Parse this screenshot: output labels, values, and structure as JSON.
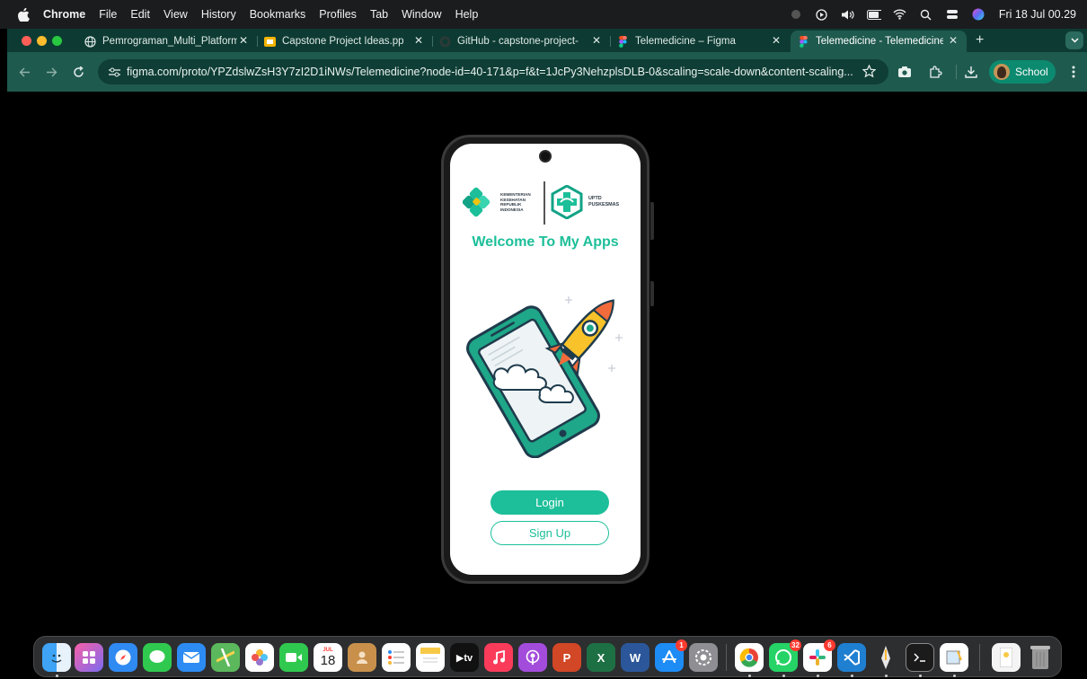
{
  "menubar": {
    "app_name": "Chrome",
    "items": [
      "File",
      "Edit",
      "View",
      "History",
      "Bookmarks",
      "Profiles",
      "Tab",
      "Window",
      "Help"
    ],
    "clock": "Fri 18 Jul 00.29"
  },
  "tabs": [
    {
      "title": "Pemrograman_Multi_Platform",
      "icon": "globe-icon"
    },
    {
      "title": "Capstone Project Ideas.pptx",
      "icon": "slides-icon"
    },
    {
      "title": "GitHub - capstone-project-pr",
      "icon": "github-icon"
    },
    {
      "title": "Telemedicine – Figma",
      "icon": "figma-icon"
    },
    {
      "title": "Telemedicine - Telemedicine",
      "icon": "figma-icon",
      "active": true
    }
  ],
  "toolbar": {
    "url": "figma.com/proto/YPZdslwZsH3Y7zI2D1iNWs/Telemedicine?node-id=40-171&p=f&t=1JcPy3NehzplsDLB-0&scaling=scale-down&content-scaling...",
    "profile_label": "School"
  },
  "app": {
    "kemenkes_lines": [
      "KEMENTERIAN",
      "KESEHATAN",
      "REPUBLIK",
      "INDONESIA"
    ],
    "puskesmas_lines": [
      "UPTD",
      "PUSKESMAS"
    ],
    "welcome": "Welcome To My Apps",
    "login_label": "Login",
    "signup_label": "Sign Up"
  },
  "dock": {
    "calendar_month": "JUL",
    "calendar_day": "18",
    "badges": {
      "app_store": "1",
      "whatsapp": "32",
      "slack": "6"
    }
  },
  "colors": {
    "brand_teal": "#1cbf99",
    "tab_strip": "#0d3b33",
    "toolbar": "#1f5a4f"
  }
}
